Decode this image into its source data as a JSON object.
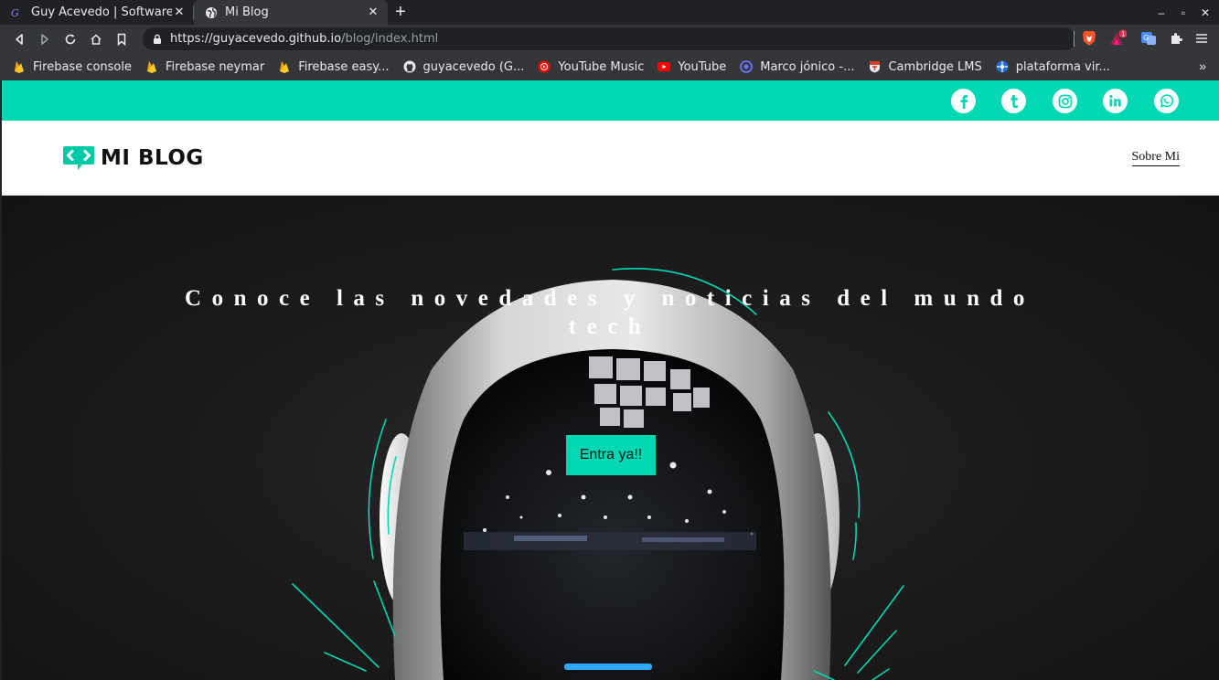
{
  "browser": {
    "tabs": [
      {
        "title": "Guy Acevedo | Software De",
        "active": false
      },
      {
        "title": "Mi Blog",
        "active": true
      }
    ],
    "new_tab": "+",
    "url": {
      "host": "https://guyacevedo.github.io",
      "path": "/blog/index.html"
    },
    "extension_badge": "1",
    "bookmarks": [
      {
        "label": "Firebase console",
        "icon": "firebase-icon"
      },
      {
        "label": "Firebase neymar",
        "icon": "firebase-icon"
      },
      {
        "label": "Firebase easy...",
        "icon": "firebase-icon"
      },
      {
        "label": "guyacevedo (G...",
        "icon": "github-icon"
      },
      {
        "label": "YouTube Music",
        "icon": "youtube-music-icon"
      },
      {
        "label": "YouTube",
        "icon": "youtube-icon"
      },
      {
        "label": "Marco jónico -...",
        "icon": "circle-icon"
      },
      {
        "label": "Cambridge LMS",
        "icon": "cambridge-icon"
      },
      {
        "label": "plataforma vir...",
        "icon": "globe-icon"
      }
    ],
    "bookmarks_more": "»"
  },
  "site": {
    "accent": "#00d8b4",
    "social": [
      "facebook-icon",
      "tumblr-icon",
      "instagram-icon",
      "linkedin-icon",
      "whatsapp-icon"
    ],
    "logo_text": "MI BLOG",
    "nav": {
      "about": "Sobre Mi"
    },
    "hero": {
      "title": "Conoce las novedades y noticias del mundo tech",
      "cta": "Entra ya!!"
    }
  }
}
